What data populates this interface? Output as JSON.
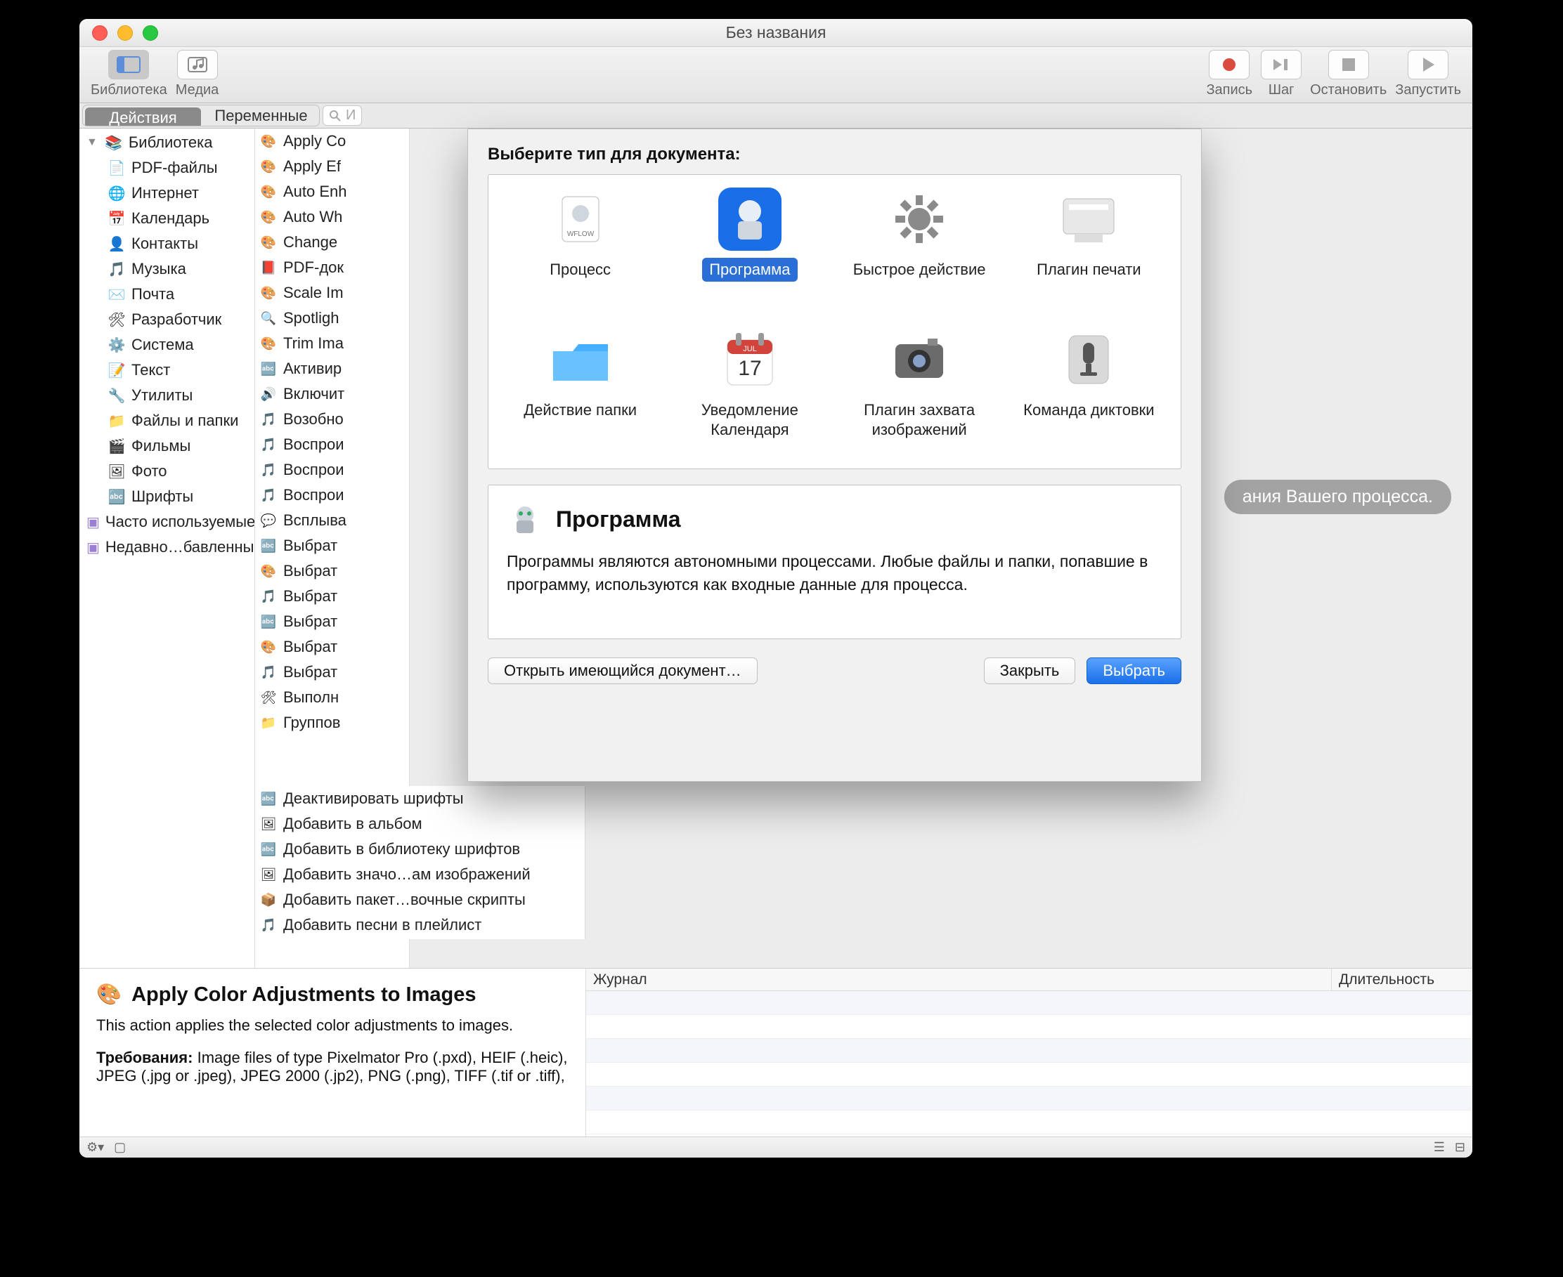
{
  "window": {
    "title": "Без названия"
  },
  "toolbar": {
    "library": "Библиотека",
    "media": "Медиа",
    "record": "Запись",
    "step": "Шаг",
    "stop": "Остановить",
    "run": "Запустить"
  },
  "seg": {
    "actions": "Действия",
    "variables": "Переменные"
  },
  "search": {
    "placeholder": "И"
  },
  "sidebar": {
    "library": "Библиотека",
    "items": [
      "PDF-файлы",
      "Интернет",
      "Календарь",
      "Контакты",
      "Музыка",
      "Почта",
      "Разработчик",
      "Система",
      "Текст",
      "Утилиты",
      "Файлы и папки",
      "Фильмы",
      "Фото",
      "Шрифты"
    ],
    "favorites": "Часто используемые",
    "recent": "Недавно…бавленные"
  },
  "actions_short": [
    "Apply Co",
    "Apply Ef",
    "Auto Enh",
    "Auto Wh",
    "Change",
    "PDF-док",
    "Scale Im",
    "Spotligh",
    "Trim Ima",
    "Активир",
    "Включит",
    "Возобно",
    "Воспрои",
    "Воспрои",
    "Воспрои",
    "Всплыва",
    "Выбрат",
    "Выбрат",
    "Выбрат",
    "Выбрат",
    "Выбрат",
    "Выбрат",
    "Выполн",
    "Группов"
  ],
  "actions_tail": [
    "Деактивировать шрифты",
    "Добавить в альбом",
    "Добавить в библиотеку шрифтов",
    "Добавить значо…ам изображений",
    "Добавить пакет…вочные скрипты",
    "Добавить песни в плейлист"
  ],
  "workflow": {
    "drop_hint_tail": "ания Вашего процесса."
  },
  "info": {
    "title": "Apply Color Adjustments to Images",
    "desc": "This action applies the selected color adjustments to images.",
    "req_label": "Требования:",
    "req_text": "Image files of type Pixelmator Pro (.pxd), HEIF (.heic), JPEG (.jpg or .jpeg), JPEG 2000 (.jp2), PNG (.png), TIFF (.tif or .tiff),"
  },
  "log": {
    "col1": "Журнал",
    "col2": "Длительность"
  },
  "sheet": {
    "heading": "Выберите тип для документа:",
    "tiles": [
      {
        "label": "Процесс"
      },
      {
        "label": "Программа",
        "selected": true
      },
      {
        "label": "Быстрое действие"
      },
      {
        "label": "Плагин печати"
      },
      {
        "label": "Действие папки"
      },
      {
        "label": "Уведомление Календаря"
      },
      {
        "label": "Плагин захвата изображений"
      },
      {
        "label": "Команда диктовки"
      }
    ],
    "desc_title": "Программа",
    "desc_body": "Программы являются автономными процессами. Любые файлы и папки, попавшие в программу, используются как входные данные для процесса.",
    "open": "Открыть имеющийся документ…",
    "cancel": "Закрыть",
    "choose": "Выбрать"
  }
}
